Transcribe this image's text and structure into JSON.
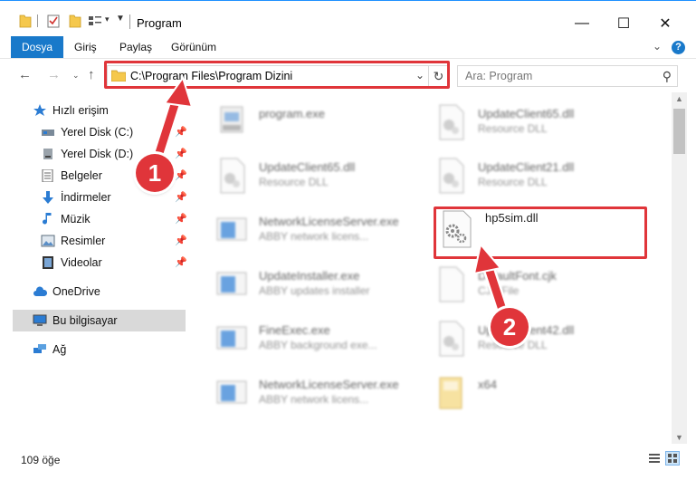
{
  "window": {
    "title": "Program",
    "minimize_icon": "—",
    "maximize_icon": "☐",
    "close_icon": "✕"
  },
  "ribbon": {
    "tabs": [
      {
        "label": "Dosya",
        "active": true
      },
      {
        "label": "Giriş",
        "active": false
      },
      {
        "label": "Paylaş",
        "active": false
      },
      {
        "label": "Görünüm",
        "active": false
      }
    ],
    "help_label": "?"
  },
  "nav": {
    "address": "C:\\Program Files\\Program Dizini",
    "search_placeholder": "Ara: Program"
  },
  "sidebar": {
    "items": [
      {
        "label": "Hızlı erişim",
        "icon": "star-icon",
        "pinned": false
      },
      {
        "label": "Yerel Disk (C:)",
        "icon": "drive-icon",
        "pinned": true
      },
      {
        "label": "Yerel Disk (D:)",
        "icon": "drive-icon",
        "pinned": true
      },
      {
        "label": "Belgeler",
        "icon": "documents-icon",
        "pinned": true
      },
      {
        "label": "İndirmeler",
        "icon": "download-icon",
        "pinned": true
      },
      {
        "label": "Müzik",
        "icon": "music-icon",
        "pinned": true
      },
      {
        "label": "Resimler",
        "icon": "pictures-icon",
        "pinned": true
      },
      {
        "label": "Videolar",
        "icon": "video-icon",
        "pinned": true
      },
      {
        "label": "OneDrive",
        "icon": "cloud-icon",
        "pinned": false
      },
      {
        "label": "Bu bilgisayar",
        "icon": "computer-icon",
        "pinned": false
      },
      {
        "label": "Ağ",
        "icon": "network-icon",
        "pinned": false
      }
    ]
  },
  "files": [
    {
      "name": "program.exe",
      "desc": "",
      "icon": "exe-setup-icon",
      "blur": true
    },
    {
      "name": "UpdateClient65.dll",
      "desc": "Resource DLL",
      "icon": "dll-icon",
      "blur": true
    },
    {
      "name": "UpdateClient65.dll",
      "desc": "Resource DLL",
      "icon": "dll-icon",
      "blur": true
    },
    {
      "name": "UpdateClient21.dll",
      "desc": "Resource DLL",
      "icon": "dll-icon",
      "blur": true
    },
    {
      "name": "NetworkLicenseServer.exe",
      "desc": "ABBY network licens...",
      "icon": "exe-window-icon",
      "blur": true
    },
    {
      "name": "hp5sim.dll",
      "desc": "",
      "icon": "dll-gear-icon",
      "blur": false
    },
    {
      "name": "UpdateInstaller.exe",
      "desc": "ABBY updates installer",
      "icon": "exe-window-icon",
      "blur": true
    },
    {
      "name": "DefaultFont.cjk",
      "desc": "CJK File",
      "icon": "blank-file-icon",
      "blur": true
    },
    {
      "name": "FineExec.exe",
      "desc": "ABBY background exe...",
      "icon": "exe-window-icon",
      "blur": true
    },
    {
      "name": "UpdateClient42.dll",
      "desc": "Resource DLL",
      "icon": "dll-icon",
      "blur": true
    },
    {
      "name": "NetworkLicenseServer.exe",
      "desc": "ABBY network licens...",
      "icon": "exe-window-icon",
      "blur": true
    },
    {
      "name": "x64",
      "desc": "",
      "icon": "folder-icon",
      "blur": true
    }
  ],
  "status": {
    "item_count": "109 öğe"
  },
  "annotations": {
    "step1": "1",
    "step2": "2"
  },
  "colors": {
    "accent": "#1979ca",
    "highlight_red": "#e0353a",
    "selected_bg": "#d9d9d9"
  }
}
